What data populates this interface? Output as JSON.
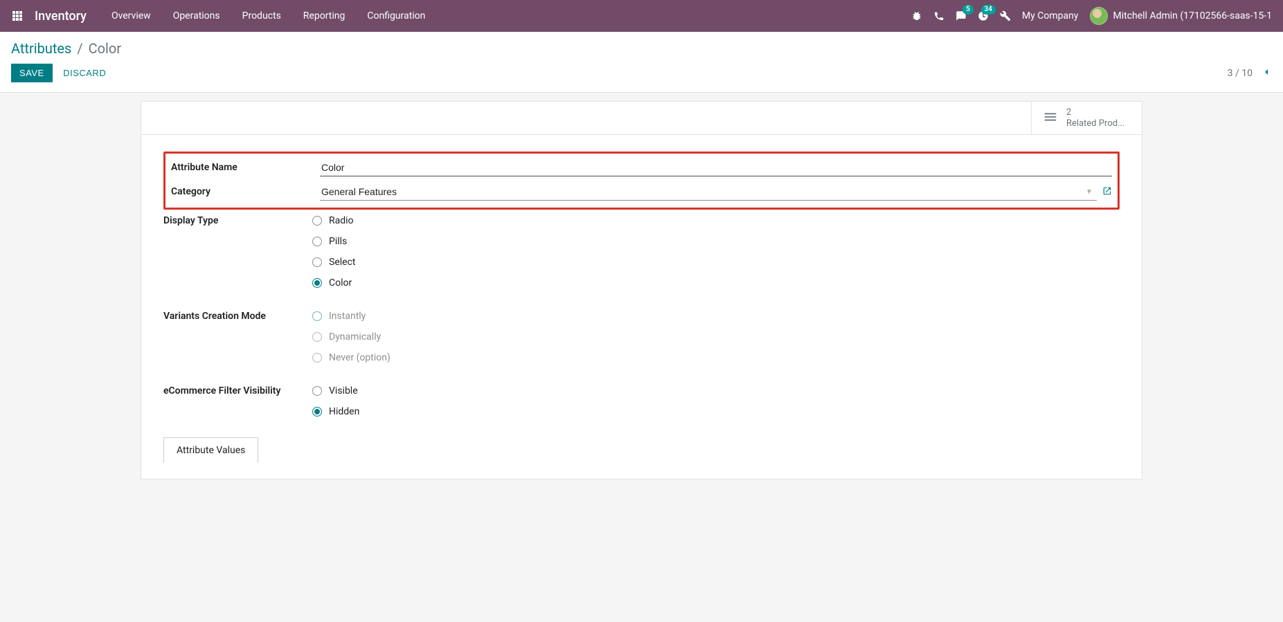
{
  "nav": {
    "brand": "Inventory",
    "menu": [
      "Overview",
      "Operations",
      "Products",
      "Reporting",
      "Configuration"
    ],
    "msg_badge": "5",
    "activity_badge": "34",
    "company": "My Company",
    "user": "Mitchell Admin (17102566-saas-15-1"
  },
  "breadcrumb": {
    "parent": "Attributes",
    "current": "Color"
  },
  "buttons": {
    "save": "Save",
    "discard": "Discard"
  },
  "pager": {
    "text": "3 / 10"
  },
  "stat": {
    "count": "2",
    "label": "Related Prod..."
  },
  "form": {
    "attr_name_label": "Attribute Name",
    "attr_name_value": "Color",
    "category_label": "Category",
    "category_value": "General Features",
    "display_type_label": "Display Type",
    "display_type_options": {
      "radio": "Radio",
      "pills": "Pills",
      "select": "Select",
      "color": "Color"
    },
    "variants_label": "Variants Creation Mode",
    "variants_options": {
      "instantly": "Instantly",
      "dynamically": "Dynamically",
      "never": "Never (option)"
    },
    "ecom_label": "eCommerce Filter Visibility",
    "ecom_options": {
      "visible": "Visible",
      "hidden": "Hidden"
    },
    "tab_values": "Attribute Values"
  }
}
